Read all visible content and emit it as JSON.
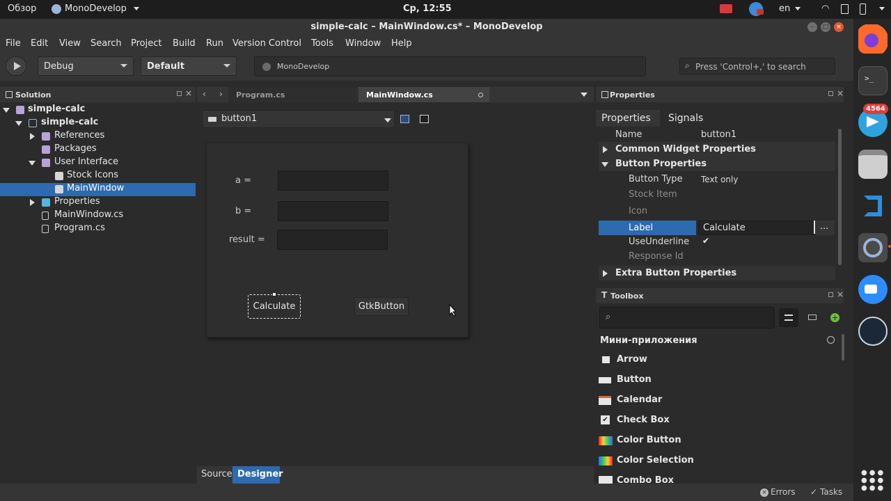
{
  "system": {
    "activities": "Обзор",
    "app_name": "MonoDevelop",
    "clock": "Ср, 12:55",
    "language": "en",
    "telegram_badge": "4564"
  },
  "window": {
    "title": "simple-calc – MainWindow.cs* – MonoDevelop"
  },
  "menu": [
    "File",
    "Edit",
    "View",
    "Search",
    "Project",
    "Build",
    "Run",
    "Version Control",
    "Tools",
    "Window",
    "Help"
  ],
  "toolbar": {
    "config": "Debug",
    "target": "Default",
    "status": "MonoDevelop",
    "search_placeholder": "Press 'Control+,' to search"
  },
  "solution": {
    "title": "Solution",
    "items": [
      {
        "label": "simple-calc",
        "level": 0,
        "icon": "solution-icon"
      },
      {
        "label": "simple-calc",
        "level": 1,
        "icon": "project-icon"
      },
      {
        "label": "References",
        "level": 2,
        "icon": "folder-icon"
      },
      {
        "label": "Packages",
        "level": 2,
        "icon": "folder-icon"
      },
      {
        "label": "User Interface",
        "level": 2,
        "icon": "folder-icon"
      },
      {
        "label": "Stock Icons",
        "level": 3,
        "icon": "stock-icons-icon"
      },
      {
        "label": "MainWindow",
        "level": 3,
        "icon": "window-icon",
        "selected": true
      },
      {
        "label": "Properties",
        "level": 2,
        "icon": "folder-icon"
      },
      {
        "label": "MainWindow.cs",
        "level": 2,
        "icon": "cs-file-icon"
      },
      {
        "label": "Program.cs",
        "level": 2,
        "icon": "cs-file-icon"
      }
    ]
  },
  "editor": {
    "tabs": [
      "Program.cs",
      "MainWindow.cs"
    ],
    "widget_selector": "button1",
    "form": {
      "label_a": "a =",
      "label_b": "b =",
      "label_result": "result =",
      "calc_button": "Calculate",
      "gtk_button": "GtkButton"
    },
    "bottom_tabs": [
      "Source",
      "Designer"
    ]
  },
  "properties": {
    "title": "Properties",
    "tabs": [
      "Properties",
      "Signals"
    ],
    "rows": {
      "name_label": "Name",
      "name_value": "button1",
      "common": "Common Widget Properties",
      "button_props": "Button Properties",
      "button_type_label": "Button Type",
      "button_type_value": "Text only",
      "stock_item": "Stock Item",
      "icon": "Icon",
      "label_label": "Label",
      "label_value": "Calculate",
      "use_underline": "UseUnderline",
      "response_id": "Response Id",
      "extra": "Extra Button Properties",
      "ellipsis": "..."
    }
  },
  "toolbox": {
    "title": "Toolbox",
    "category": "Мини-приложения",
    "items": [
      "Arrow",
      "Button",
      "Calendar",
      "Check Box",
      "Color Button",
      "Color Selection",
      "Combo Box"
    ]
  },
  "status": {
    "errors": "Errors",
    "tasks": "Tasks"
  },
  "colors": {
    "selection": "#2d6ab0",
    "accent_blue": "#3b74b8"
  }
}
